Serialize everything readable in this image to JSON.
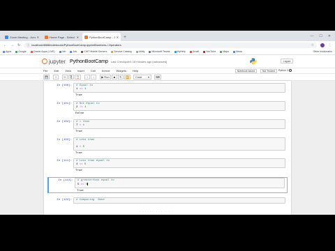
{
  "browser": {
    "tabs": [
      {
        "label": "Zoom Meeting - Jump to ha...",
        "color": "#2d8cff",
        "active": false
      },
      {
        "label": "Home Page - Select or create...",
        "color": "#f37626",
        "active": false
      },
      {
        "label": "PythonBootCamp - Jupyter No...",
        "color": "#f37626",
        "active": true
      }
    ],
    "new_tab": "+",
    "window_controls": [
      "—",
      "☐",
      "✕"
    ],
    "nav_back": "←",
    "nav_forward": "→",
    "nav_reload": "↻",
    "url": "localhost:8888/notebooks/PythonBootCamp.ipynb#Numbers-/-Operators",
    "bookmarks": [
      "Apps",
      "Google",
      "Oracle Apps (LIVE)",
      "Job",
      "Job",
      "CWT Mobile Servers",
      "Service Catalog",
      "Utility",
      "Microsoft Teams",
      "MyHelp",
      "Gmail",
      "YouTube",
      "Maps",
      "News"
    ],
    "bookmark_colors": [
      "#4285f4",
      "#34a853",
      "#f44336",
      "#4285f4",
      "#4285f4",
      "#6d4c41",
      "#ff9800",
      "#9e9e9e",
      "#5c6bc0",
      "#2196f3",
      "#ea4335",
      "#ff0000",
      "#34a853",
      "#4285f4"
    ],
    "other_bookmarks": "Other bookmarks"
  },
  "jupyter": {
    "logo_text": "jupyter",
    "notebook_name": "PythonBootCamp",
    "checkpoint": "Last Checkpoint: 18 minutes ago  (autosaved)",
    "logout": "Logout",
    "menus": [
      "File",
      "Edit",
      "View",
      "Insert",
      "Cell",
      "Kernel",
      "Widgets",
      "Help"
    ],
    "trusted": "Notebook saved",
    "not_trusted": "Not Trusted",
    "kernel_name": "Python 3",
    "toolbar": {
      "save": "💾",
      "add": "+",
      "cut": "✂",
      "copy": "⎘",
      "paste": "📋",
      "up": "↑",
      "down": "↓",
      "run": "Run",
      "run_icon": "▶",
      "stop": "■",
      "restart": "↻",
      "fastforward": "⏩",
      "cell_type": "Code",
      "cell_type_arrow": "▾",
      "keyboard": "⌨"
    }
  },
  "cells": [
    {
      "prompt": "In [100]:",
      "lines": [
        [
          [
            "cmt",
            "# Equal to"
          ]
        ],
        [
          [
            "",
            "1 "
          ],
          [
            "op",
            "=="
          ],
          [
            "",
            " "
          ],
          [
            "num",
            "1"
          ]
        ]
      ],
      "output": "True"
    },
    {
      "prompt": "In [101]:",
      "lines": [
        [
          [
            "cmt",
            "# Not Equal to"
          ]
        ],
        [
          [
            "",
            "2 "
          ],
          [
            "op",
            "!="
          ],
          [
            "",
            " "
          ],
          [
            "num",
            "1"
          ]
        ]
      ],
      "output": "False"
    },
    {
      "prompt": "In [102]:",
      "lines": [
        [
          [
            "cmt",
            "# < than"
          ]
        ],
        [
          [
            "",
            "7 "
          ],
          [
            "op",
            "<"
          ],
          [
            "",
            " "
          ],
          [
            "num",
            "1"
          ]
        ]
      ],
      "output": "True"
    },
    {
      "prompt": "In [103]:",
      "lines": [
        [
          [
            "cmt",
            "# Less than"
          ]
        ],
        [
          [
            "",
            ""
          ]
        ],
        [
          [
            "",
            "1 "
          ],
          [
            "op",
            "<"
          ],
          [
            "",
            " "
          ],
          [
            "num",
            "5"
          ]
        ]
      ],
      "output": "True"
    },
    {
      "prompt": "In [111]:",
      "lines": [
        [
          [
            "cmt",
            "# Less than equal to"
          ]
        ],
        [
          [
            "",
            "4 "
          ],
          [
            "op",
            "<="
          ],
          [
            "",
            " "
          ],
          [
            "num",
            "5"
          ]
        ]
      ],
      "output": "True"
    },
    {
      "prompt": "In [113]:",
      "lines": [
        [
          [
            "cmt",
            "# greaterthan equal to"
          ]
        ],
        [
          [
            "",
            "5 "
          ],
          [
            "op",
            ">="
          ],
          [
            "",
            " "
          ],
          [
            "num",
            "5"
          ]
        ]
      ],
      "output": "True",
      "selected": true
    },
    {
      "prompt": "In [122]:",
      "lines": [
        [
          [
            "cmt",
            "# Comparing  None"
          ]
        ]
      ],
      "output": ""
    }
  ],
  "out_prompt_label": "",
  "footer_hint": "· · · ·  ·· · · ·  ·  · · ·"
}
